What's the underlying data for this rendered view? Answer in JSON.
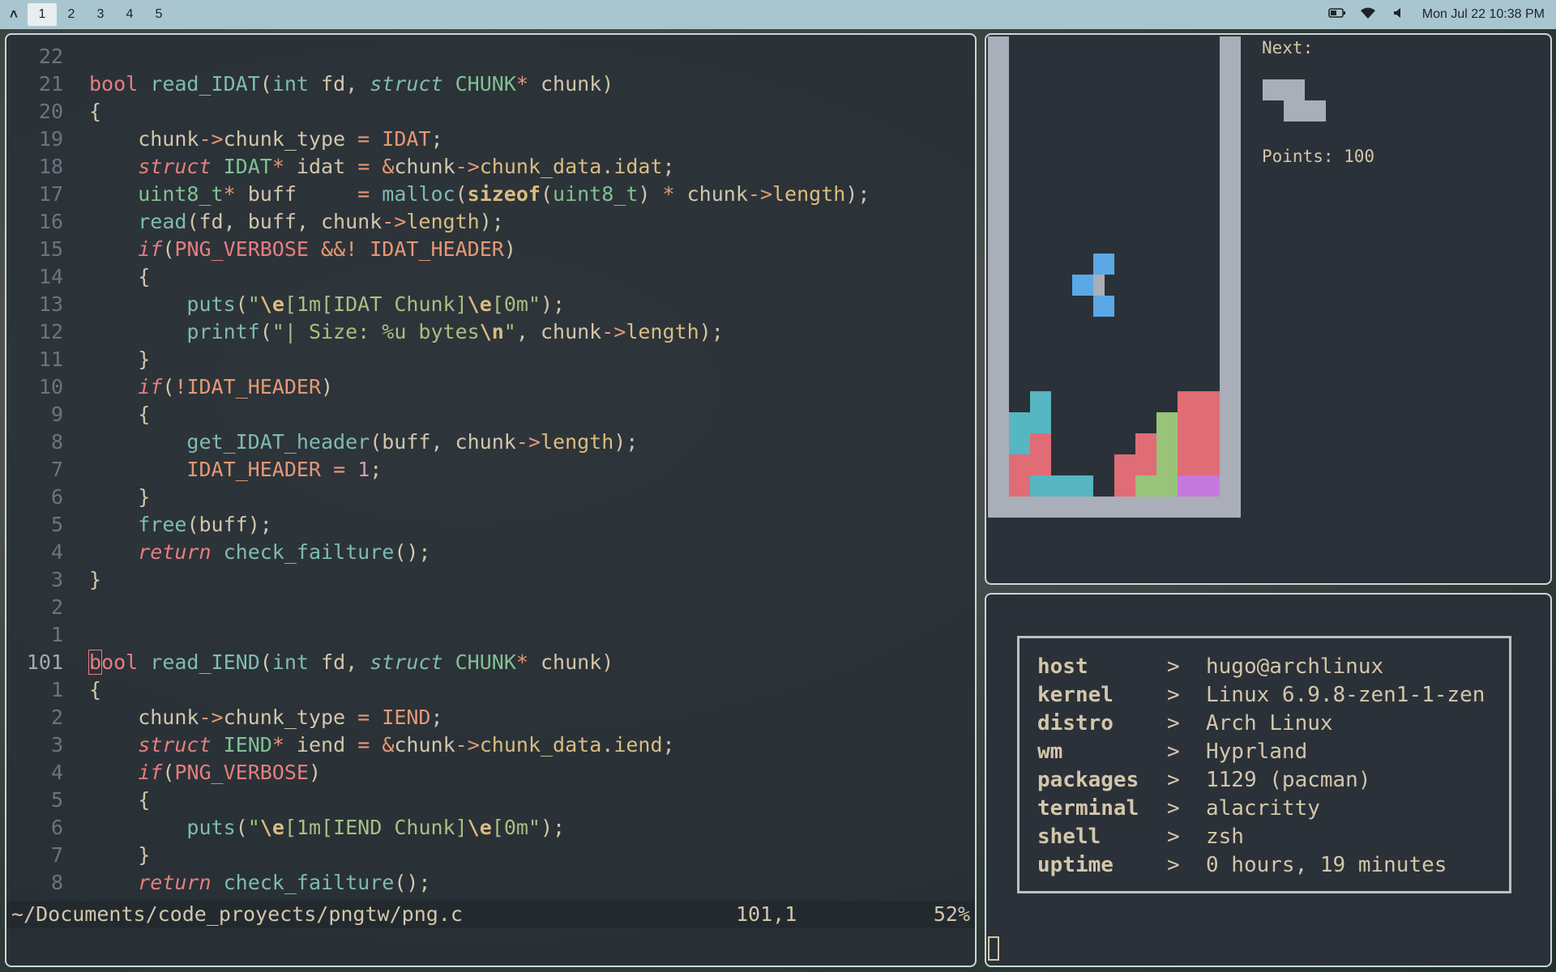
{
  "topbar": {
    "logo_icon": "arch-logo-icon",
    "workspaces": [
      "1",
      "2",
      "3",
      "4",
      "5"
    ],
    "active_workspace": "1",
    "battery_icon": "battery-icon",
    "wifi_icon": "wifi-icon",
    "volume_icon": "volume-icon",
    "clock": "Mon Jul 22  10:38 PM"
  },
  "editor": {
    "lines": [
      {
        "num": "22",
        "text": ""
      },
      {
        "num": "21",
        "text": "bool read_IDAT(int fd, struct CHUNK* chunk)"
      },
      {
        "num": "20",
        "text": "{"
      },
      {
        "num": "19",
        "text": "    chunk->chunk_type = IDAT;"
      },
      {
        "num": "18",
        "text": "    struct IDAT* idat = &chunk->chunk_data.idat;"
      },
      {
        "num": "17",
        "text": "    uint8_t* buff     = malloc(sizeof(uint8_t) * chunk->length);"
      },
      {
        "num": "16",
        "text": "    read(fd, buff, chunk->length);"
      },
      {
        "num": "15",
        "text": "    if(PNG_VERBOSE &&! IDAT_HEADER)"
      },
      {
        "num": "14",
        "text": "    {"
      },
      {
        "num": "13",
        "text": "        puts(\"\\e[1m[IDAT Chunk]\\e[0m\");"
      },
      {
        "num": "12",
        "text": "        printf(\"| Size: %u bytes\\n\", chunk->length);"
      },
      {
        "num": "11",
        "text": "    }"
      },
      {
        "num": "10",
        "text": "    if(!IDAT_HEADER)"
      },
      {
        "num": "9",
        "text": "    {"
      },
      {
        "num": "8",
        "text": "        get_IDAT_header(buff, chunk->length);"
      },
      {
        "num": "7",
        "text": "        IDAT_HEADER = 1;"
      },
      {
        "num": "6",
        "text": "    }"
      },
      {
        "num": "5",
        "text": "    free(buff);"
      },
      {
        "num": "4",
        "text": "    return check_failture();"
      },
      {
        "num": "3",
        "text": "}"
      },
      {
        "num": "2",
        "text": ""
      },
      {
        "num": "1",
        "text": ""
      },
      {
        "num": "101",
        "text": "bool read_IEND(int fd, struct CHUNK* chunk)"
      },
      {
        "num": "1",
        "text": "{"
      },
      {
        "num": "2",
        "text": "    chunk->chunk_type = IEND;"
      },
      {
        "num": "3",
        "text": "    struct IEND* iend = &chunk->chunk_data.iend;"
      },
      {
        "num": "4",
        "text": "    if(PNG_VERBOSE)"
      },
      {
        "num": "5",
        "text": "    {"
      },
      {
        "num": "6",
        "text": "        puts(\"\\e[1m[IEND Chunk]\\e[0m\");"
      },
      {
        "num": "7",
        "text": "    }"
      },
      {
        "num": "8",
        "text": "    return check_failture();"
      }
    ],
    "status": {
      "path": "~/Documents/code_proyects/pngtw/png.c",
      "position": "101,1",
      "percent": "52%"
    }
  },
  "tetris": {
    "next_label": "Next:",
    "points_label": "Points: 100",
    "colors": {
      "blue": "#5aa9e6",
      "cyan": "#56b6c2",
      "red": "#e06c75",
      "green": "#98c379",
      "purple": "#c678dd",
      "gray": "#a9aeb8"
    }
  },
  "fetch": {
    "rows": [
      {
        "key": "host",
        "arrow": ">",
        "value": "hugo@archlinux"
      },
      {
        "key": "kernel",
        "arrow": ">",
        "value": "Linux 6.9.8-zen1-1-zen"
      },
      {
        "key": "distro",
        "arrow": ">",
        "value": "Arch Linux"
      },
      {
        "key": "wm",
        "arrow": ">",
        "value": "Hyprland"
      },
      {
        "key": "packages",
        "arrow": ">",
        "value": "1129 (pacman)"
      },
      {
        "key": "terminal",
        "arrow": ">",
        "value": "alacritty"
      },
      {
        "key": "shell",
        "arrow": ">",
        "value": "zsh"
      },
      {
        "key": "uptime",
        "arrow": ">",
        "value": "0 hours, 19 minutes"
      }
    ]
  }
}
